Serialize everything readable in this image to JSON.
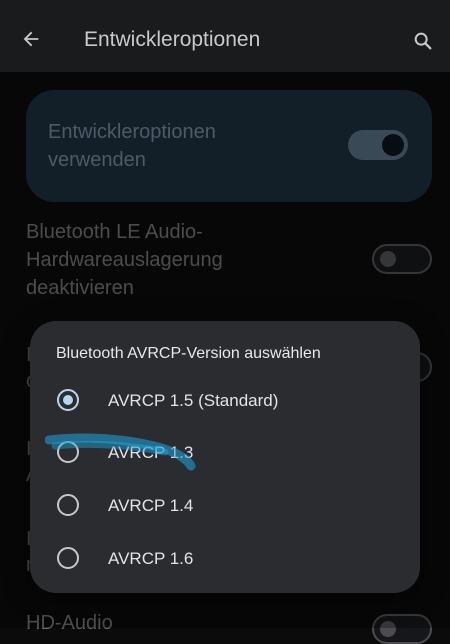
{
  "header": {
    "title": "Entwickleroptionen",
    "back_icon": "arrow-back-icon",
    "search_icon": "search-icon"
  },
  "main_toggle": {
    "label": "Entwickleroptionen verwenden",
    "checked": true
  },
  "settings": [
    {
      "label": "Bluetooth LE Audio-Hardwareauslagerung deaktivieren",
      "checked": false
    }
  ],
  "background_partial": {
    "bottom_label": "HD-Audio"
  },
  "dialog": {
    "title": "Bluetooth AVRCP-Version auswählen",
    "options": [
      {
        "label": "AVRCP 1.5 (Standard)",
        "selected": true
      },
      {
        "label": "AVRCP 1.3",
        "selected": false
      },
      {
        "label": "AVRCP 1.4",
        "selected": false
      },
      {
        "label": "AVRCP 1.6",
        "selected": false
      }
    ]
  },
  "colors": {
    "accent": "#b8d4ee",
    "highlight_stroke": "#1fa8e0"
  }
}
